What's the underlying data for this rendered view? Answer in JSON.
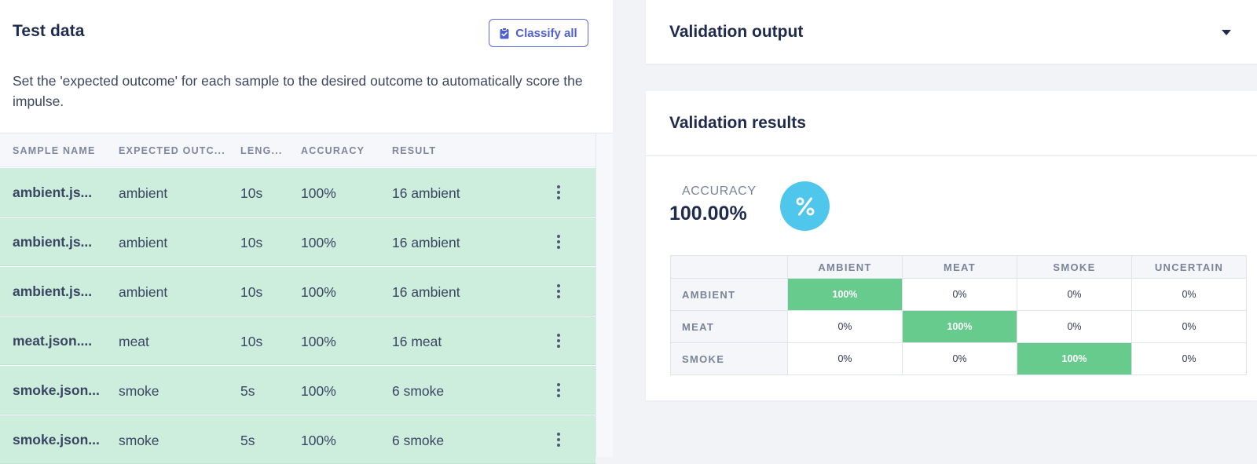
{
  "test_data": {
    "title": "Test data",
    "classify_all_label": "Classify all",
    "description": "Set the 'expected outcome' for each sample to the desired outcome to automatically score the impulse.",
    "columns": [
      "SAMPLE NAME",
      "EXPECTED OUTC...",
      "LENG...",
      "ACCURACY",
      "RESULT"
    ],
    "rows": [
      {
        "name": "ambient.js...",
        "expected": "ambient",
        "length": "10s",
        "accuracy": "100%",
        "result": "16 ambient"
      },
      {
        "name": "ambient.js...",
        "expected": "ambient",
        "length": "10s",
        "accuracy": "100%",
        "result": "16 ambient"
      },
      {
        "name": "ambient.js...",
        "expected": "ambient",
        "length": "10s",
        "accuracy": "100%",
        "result": "16 ambient"
      },
      {
        "name": "meat.json....",
        "expected": "meat",
        "length": "10s",
        "accuracy": "100%",
        "result": "16 meat"
      },
      {
        "name": "smoke.json...",
        "expected": "smoke",
        "length": "5s",
        "accuracy": "100%",
        "result": "6 smoke"
      },
      {
        "name": "smoke.json...",
        "expected": "smoke",
        "length": "5s",
        "accuracy": "100%",
        "result": "6 smoke"
      }
    ]
  },
  "validation_output": {
    "title": "Validation output"
  },
  "validation_results": {
    "title": "Validation results",
    "accuracy_label": "ACCURACY",
    "accuracy_value": "100.00%",
    "accuracy_icon": "percent-icon",
    "matrix": {
      "columns": [
        "AMBIENT",
        "MEAT",
        "SMOKE",
        "UNCERTAIN"
      ],
      "rows": [
        {
          "label": "AMBIENT",
          "values": [
            "100%",
            "0%",
            "0%",
            "0%"
          ]
        },
        {
          "label": "MEAT",
          "values": [
            "0%",
            "100%",
            "0%",
            "0%"
          ]
        },
        {
          "label": "SMOKE",
          "values": [
            "0%",
            "0%",
            "100%",
            "0%"
          ]
        }
      ]
    }
  },
  "colors": {
    "row_highlight": "#cdeedd",
    "matrix_hit": "#66cb8c",
    "accent": "#4f5fd1",
    "accuracy_circle": "#4fc6ec"
  }
}
